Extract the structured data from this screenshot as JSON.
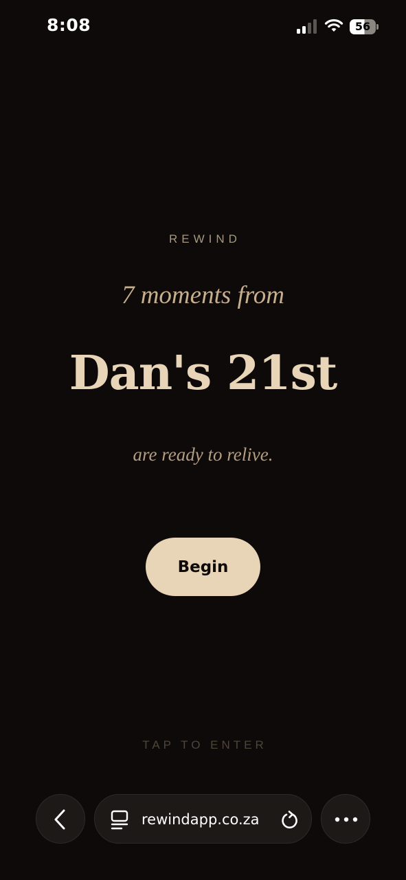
{
  "status_bar": {
    "time": "8:08",
    "battery_level": "56",
    "icons": [
      "signal-icon",
      "wifi-icon",
      "battery-icon"
    ]
  },
  "main": {
    "brand": "REWIND",
    "intro": "7 moments from",
    "event_title": "Dan's 21st",
    "subline": "are ready to relive.",
    "begin_label": "Begin",
    "tap_hint": "TAP TO ENTER"
  },
  "browser": {
    "url": "rewindapp.co.za",
    "icons": [
      "back-icon",
      "reader-icon",
      "reload-icon",
      "more-icon"
    ]
  },
  "colors": {
    "background": "#0d0a09",
    "accent": "#e8d5b7",
    "muted_text": "#a69883",
    "italic_text": "#c7ae8d"
  }
}
